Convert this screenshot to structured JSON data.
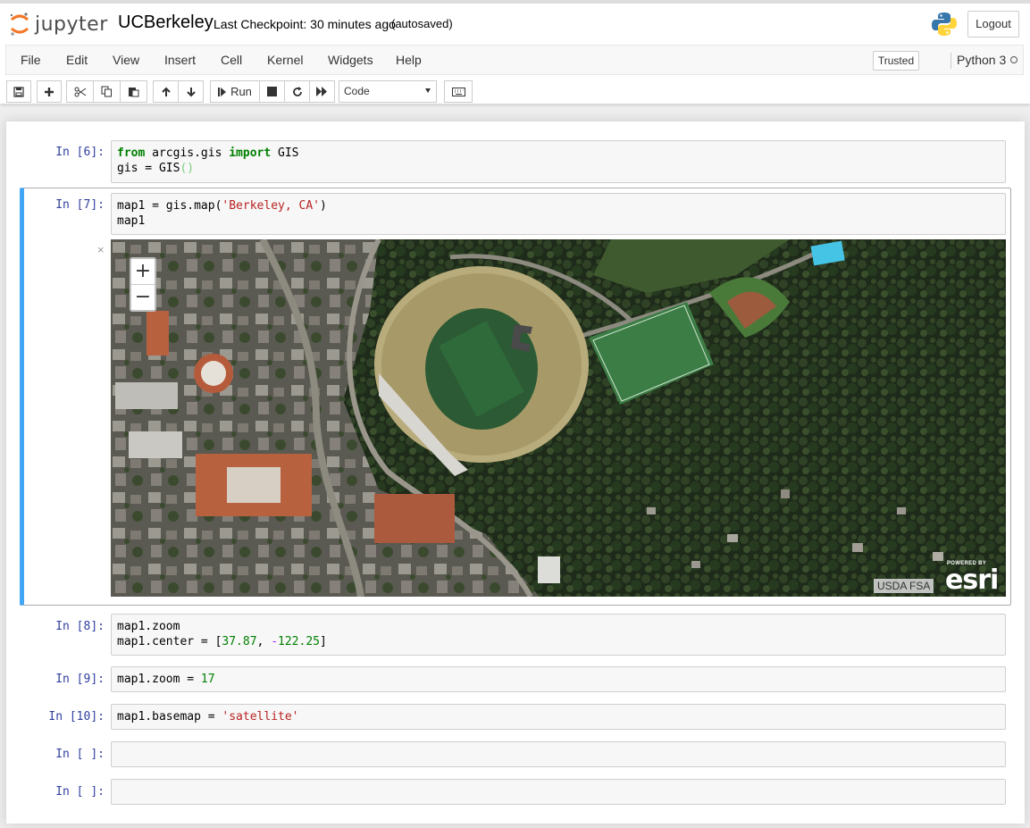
{
  "header": {
    "logo_text": "jupyter",
    "notebook_name": "UCBerkeley",
    "checkpoint": "Last Checkpoint: 30 minutes ago",
    "autosave": "(autosaved)",
    "logout_label": "Logout"
  },
  "menubar": {
    "items": [
      "File",
      "Edit",
      "View",
      "Insert",
      "Cell",
      "Kernel",
      "Widgets",
      "Help"
    ],
    "trusted_label": "Trusted",
    "kernel_name": "Python 3"
  },
  "toolbar": {
    "run_label": "Run",
    "cell_type": "Code"
  },
  "cells": [
    {
      "prompt": "In [6]:",
      "lines": [
        "from arcgis.gis import GIS",
        "gis = GIS()"
      ]
    },
    {
      "prompt": "In [7]:",
      "lines": [
        "map1 = gis.map('Berkeley, CA')",
        "map1"
      ]
    },
    {
      "prompt": "In [8]:",
      "lines": [
        "map1.zoom",
        "map1.center = [37.87, -122.25]"
      ]
    },
    {
      "prompt": "In [9]:",
      "lines": [
        "map1.zoom = 17"
      ]
    },
    {
      "prompt": "In [10]:",
      "lines": [
        "map1.basemap = 'satellite'"
      ]
    },
    {
      "prompt": "In [ ]:",
      "lines": []
    },
    {
      "prompt": "In [ ]:",
      "lines": []
    }
  ],
  "output": {
    "close_symbol": "×"
  },
  "map": {
    "zoom_in": "+",
    "zoom_out": "−",
    "attribution": "USDA FSA",
    "powered_by": "POWERED BY",
    "esri_logo": "esri"
  },
  "colors": {
    "prompt": "#303F9F",
    "selected_border": "#42A5F5",
    "keyword": "#008000",
    "string": "#BA2121"
  }
}
